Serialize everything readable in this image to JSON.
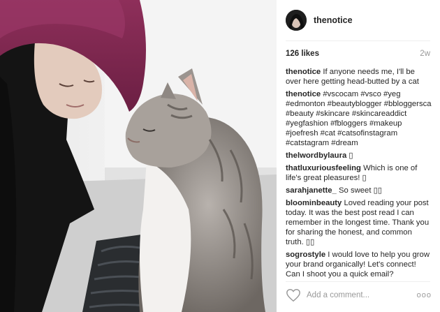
{
  "post": {
    "username": "thenotice",
    "likes": "126 likes",
    "time": "2w"
  },
  "comments": [
    {
      "user": "thenotice",
      "text": "If anyone needs me, I'll be over here getting head-butted by a cat"
    },
    {
      "user": "thenotice",
      "text": "#vscocam #vsco #yeg #edmonton #beautyblogger #bbloggersca #beauty #skincare #skincareaddict #yegfashion #fbloggers #makeup #joefresh #cat #catsofinstagram #catstagram #dream"
    },
    {
      "user": "thelwordbylaura",
      "text": "▯"
    },
    {
      "user": "thatluxuriousfeeling",
      "text": "Which is one of life's great pleasures! ▯"
    },
    {
      "user": "sarahjanette_",
      "text": "So sweet ▯▯"
    },
    {
      "user": "bloominbeauty",
      "text": "Loved reading your post today. It was the best post read I can remember in the longest time. Thank you for sharing the honest, and common truth. ▯▯"
    },
    {
      "user": "sogrostyle",
      "text": "I would love to help you grow your brand organically! Let's connect! Can I shoot you a quick email?"
    }
  ],
  "footer": {
    "placeholder": "Add a comment...",
    "more": "ooo"
  },
  "icons": {
    "heart": "heart-icon",
    "more": "more-options-icon"
  }
}
